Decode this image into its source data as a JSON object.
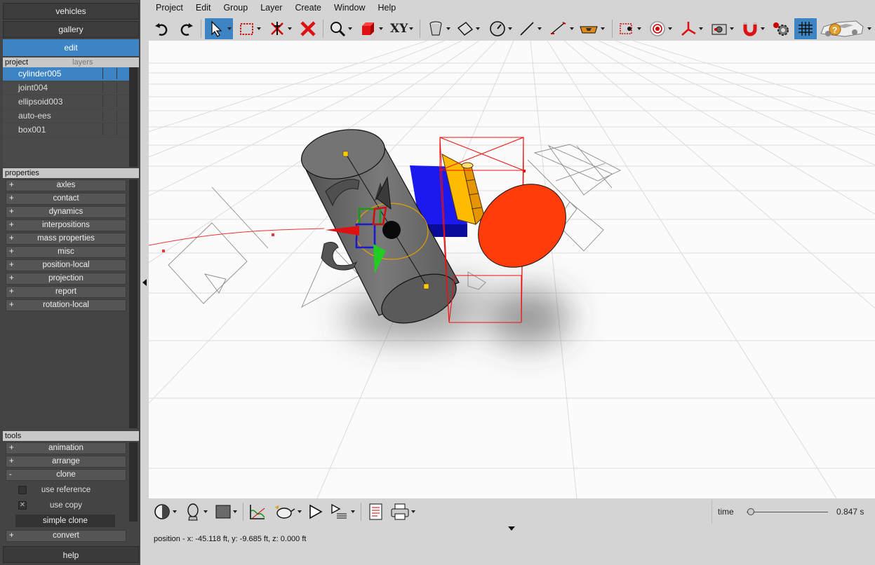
{
  "left_panel": {
    "top_buttons": [
      "vehicles",
      "gallery",
      "edit"
    ],
    "project_header": "project",
    "layers_tab": "layers",
    "project_items": [
      "cylinder005",
      "joint004",
      "ellipsoid003",
      "auto-ees",
      "box001"
    ],
    "selected_item": "cylinder005",
    "properties_header": "properties",
    "properties": [
      "axles",
      "contact",
      "dynamics",
      "interpositions",
      "mass properties",
      "misc",
      "position-local",
      "projection",
      "report",
      "rotation-local"
    ],
    "tools_header": "tools",
    "tools": [
      {
        "label": "animation",
        "sign": "+"
      },
      {
        "label": "arrange",
        "sign": "+"
      },
      {
        "label": "clone",
        "sign": "-"
      }
    ],
    "clone_options": {
      "use_reference": "use reference",
      "use_copy": "use copy",
      "use_copy_mark": "✕",
      "simple_clone": "simple clone"
    },
    "convert": {
      "label": "convert",
      "sign": "+"
    },
    "help": "help"
  },
  "menubar": [
    "Project",
    "Edit",
    "Group",
    "Layer",
    "Create",
    "Window",
    "Help"
  ],
  "toolbar": {
    "xy_label": "XY",
    "icons": [
      "undo-icon",
      "redo-icon",
      "select-arrow-icon",
      "marquee-select-icon",
      "bone-delete-icon",
      "delete-icon",
      "zoom-icon",
      "cube-icon",
      "xy-plane-label",
      "bucket-icon",
      "plane-icon",
      "gauge-icon",
      "line-icon",
      "measure-icon",
      "vehicle-icon",
      "camera-box-icon",
      "target-icon",
      "axis-icon",
      "camera-icon",
      "magnet-icon",
      "gear-settings-icon",
      "grid-icon",
      "help-icon"
    ]
  },
  "bottom_bar": {
    "status_text": "position - x: -45.118 ft, y: -9.685 ft, z: 0.000 ft",
    "time_label": "time",
    "time_value": "0.847 s",
    "time_fraction": 0.05
  },
  "colors": {
    "accent": "#3c84c4",
    "panel_bg": "#444444",
    "cylinder": "#6e6e6e",
    "box": "#1a1aee",
    "ellipsoid": "#ff3c0a",
    "hinge": "#ffbb00",
    "bbox": "#ee0000"
  }
}
